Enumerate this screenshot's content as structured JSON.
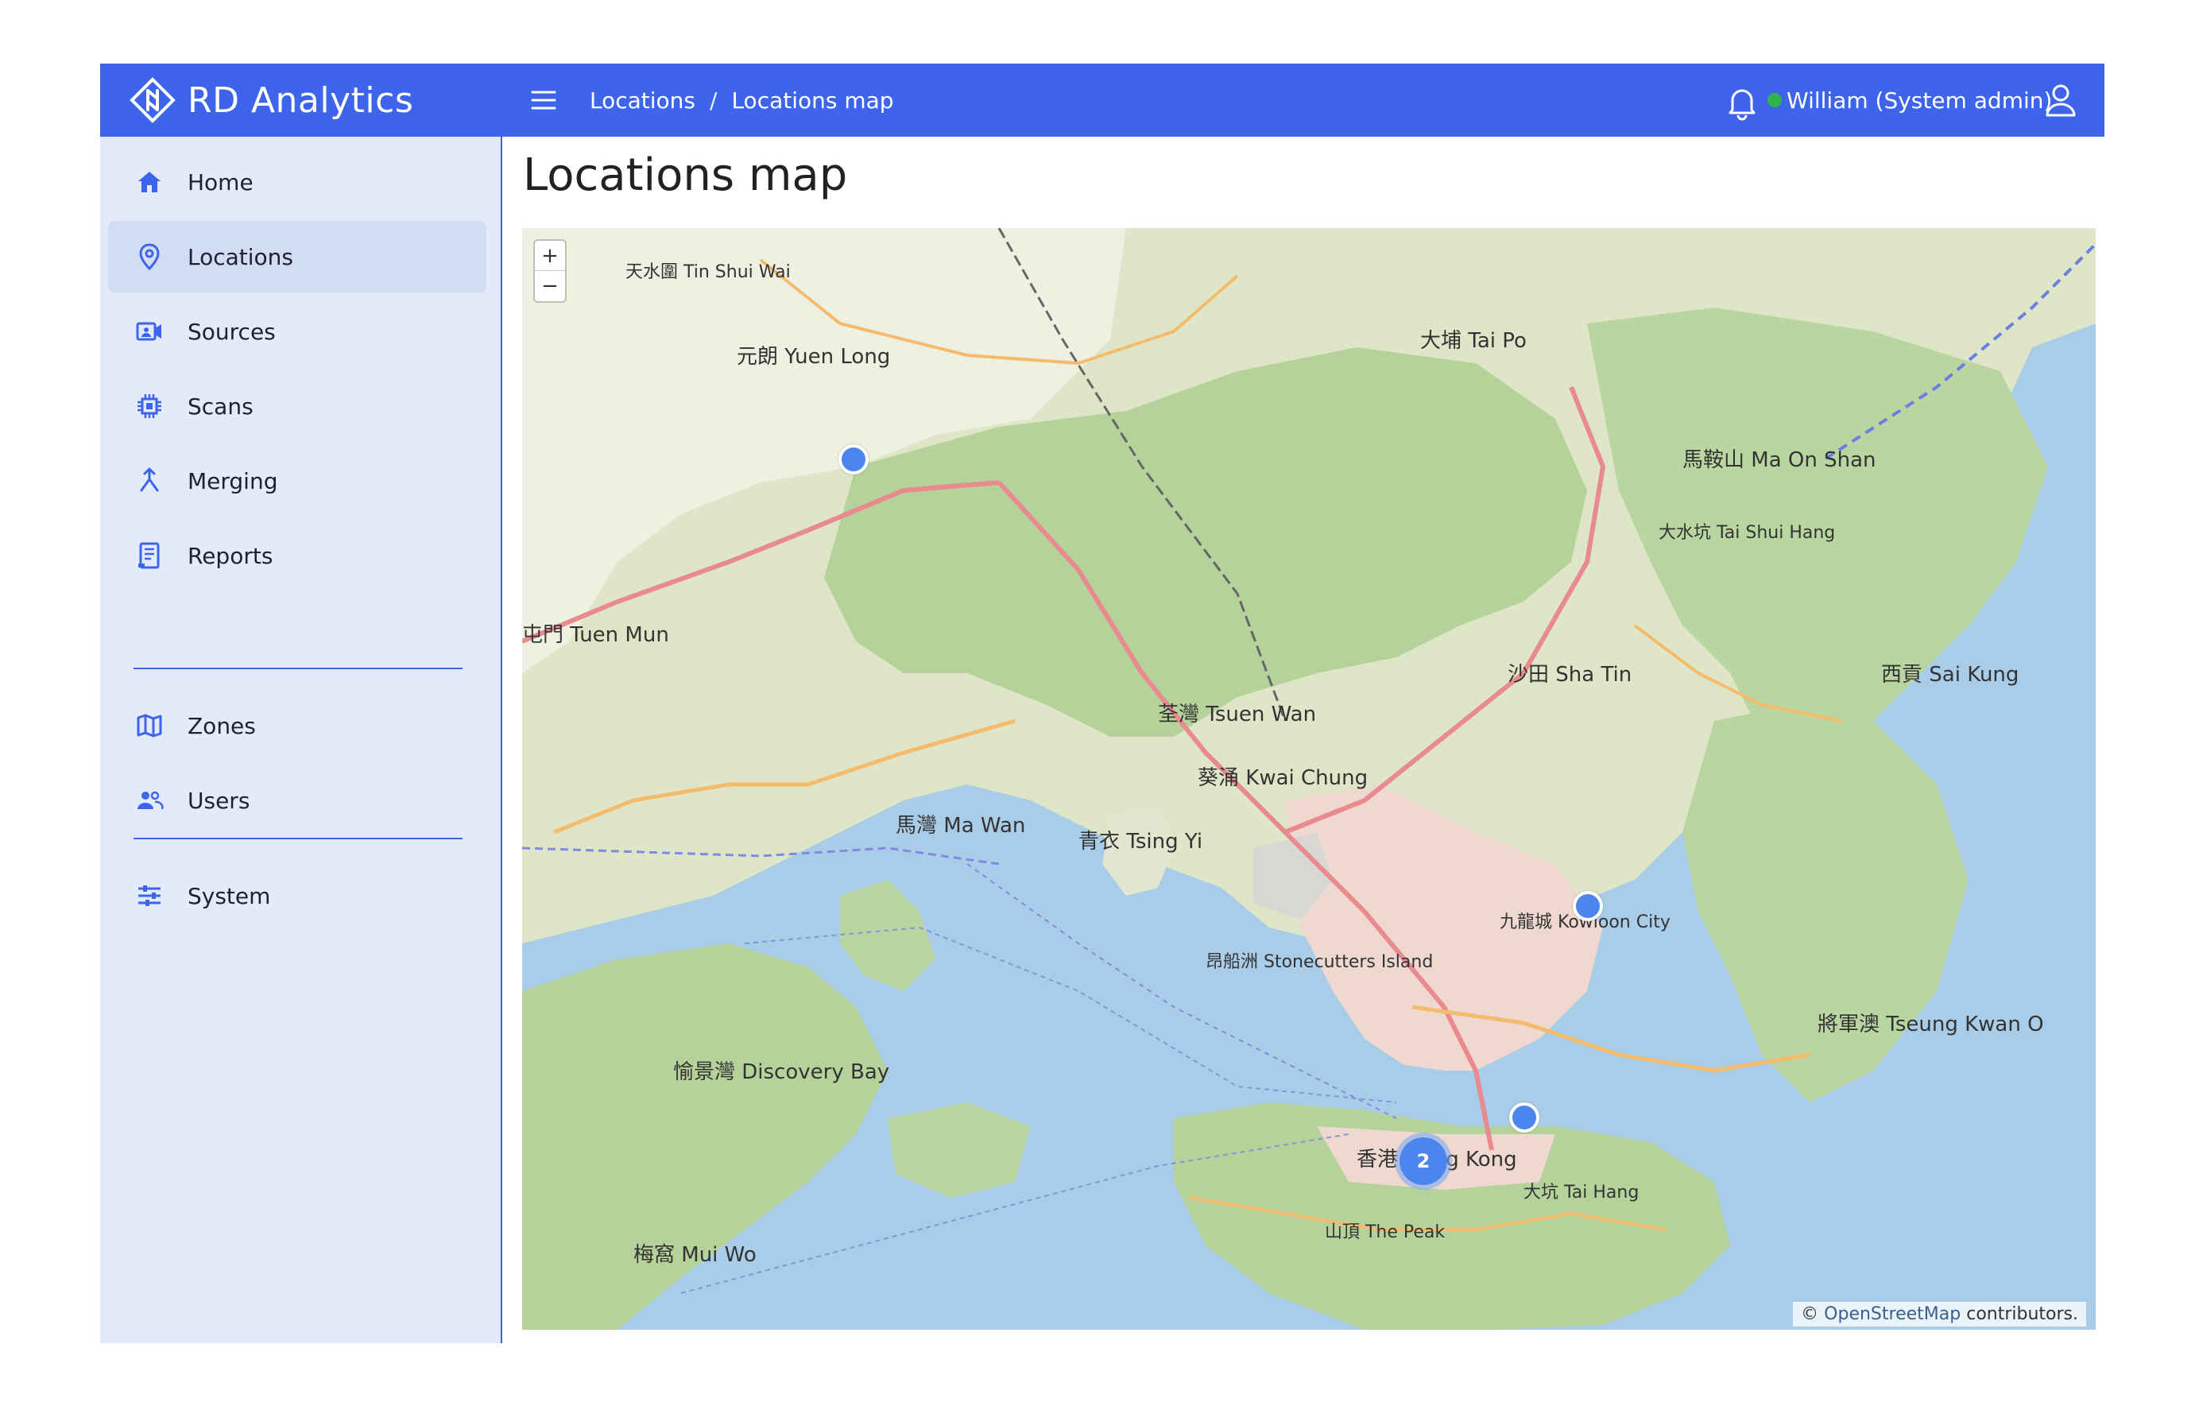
{
  "brand": {
    "name": "RD Analytics"
  },
  "header": {
    "breadcrumbs": [
      "Locations",
      "Locations map"
    ],
    "breadcrumb_separator": "/",
    "status_color": "#2fb54a",
    "user": "William (System admin)"
  },
  "sidebar": {
    "items": [
      {
        "label": "Home",
        "icon": "home-icon"
      },
      {
        "label": "Locations",
        "icon": "location-pin-icon",
        "active": true
      },
      {
        "label": "Sources",
        "icon": "camera-icon"
      },
      {
        "label": "Scans",
        "icon": "chip-icon"
      },
      {
        "label": "Merging",
        "icon": "merge-icon"
      },
      {
        "label": "Reports",
        "icon": "report-icon"
      },
      {
        "label": "Zones",
        "icon": "map-icon"
      },
      {
        "label": "Users",
        "icon": "users-icon"
      },
      {
        "label": "System",
        "icon": "sliders-icon"
      }
    ]
  },
  "page": {
    "title": "Locations map"
  },
  "map": {
    "zoom_in": "+",
    "zoom_out": "−",
    "cluster_count": "2",
    "attribution_prefix": "©",
    "attribution_link": "OpenStreetMap",
    "attribution_suffix": "contributors.",
    "places": [
      "天水圍 Tin Shui Wai",
      "元朗 Yuen Long",
      "大埔 Tai Po",
      "屯門 Tuen Mun",
      "荃灣 Tsuen Wan",
      "葵涌 Kwai Chung",
      "沙田 Sha Tin",
      "西貢 Sai Kung",
      "青衣 Tsing Yi",
      "馬灣 Ma Wan",
      "愉景灣 Discovery Bay",
      "九龍城 Kowloon City",
      "將軍澳 Tseung Kwan O",
      "香港 Hong Kong",
      "梅窩 Mui Wo",
      "馬鞍山 Ma On Shan",
      "大水坑 Tai Shui Hang",
      "昂船洲 Stonecutters Island",
      "大坑 Tai Hang",
      "山頂 The Peak"
    ]
  },
  "colors": {
    "accent": "#3d64ea",
    "sidebar_bg": "#e3eafa",
    "marker": "#4b86ef"
  }
}
